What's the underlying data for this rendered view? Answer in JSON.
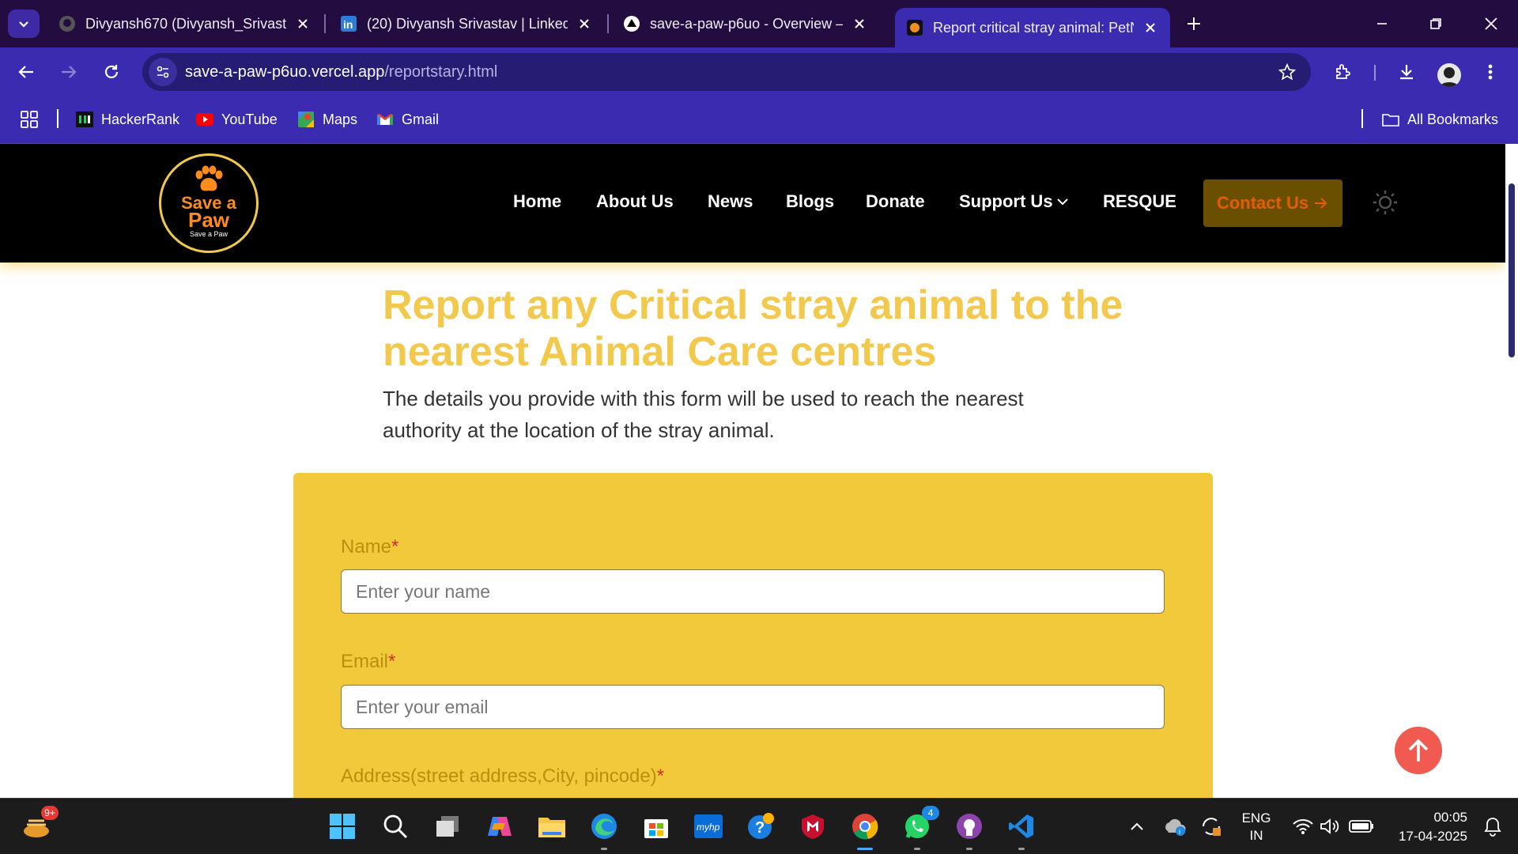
{
  "tabs": [
    {
      "title": "Divyansh670 (Divyansh_Srivasta",
      "icon": "github-icon"
    },
    {
      "title": "(20) Divyansh Srivastav | LinkedI",
      "icon": "linkedin-icon"
    },
    {
      "title": "save-a-paw-p6uo - Overview –",
      "icon": "vercel-icon"
    },
    {
      "title": "Report critical stray animal: PetN",
      "icon": "save-a-paw-icon"
    }
  ],
  "omnibox": {
    "domain": "save-a-paw-p6uo.vercel.app",
    "path": "/reportstary.html"
  },
  "bookmarks": {
    "items": [
      {
        "label": "HackerRank",
        "icon": "hackerrank-icon"
      },
      {
        "label": "YouTube",
        "icon": "youtube-icon"
      },
      {
        "label": "Maps",
        "icon": "maps-icon"
      },
      {
        "label": "Gmail",
        "icon": "gmail-icon"
      }
    ],
    "all_bookmarks": "All Bookmarks"
  },
  "site": {
    "logo": {
      "line1": "Save a",
      "line2": "Paw",
      "line3": "Save a Paw"
    },
    "nav": [
      "Home",
      "About Us",
      "News",
      "Blogs",
      "Donate",
      "Support Us",
      "RESQUE"
    ],
    "contact_label": "Contact Us",
    "heading": "Report any Critical stray animal to the nearest Animal Care centres",
    "lead": "The details you provide with this form will be used to reach the nearest authority at the location of the stray animal.",
    "form": {
      "name_label": "Name",
      "name_placeholder": "Enter your name",
      "email_label": "Email",
      "email_placeholder": "Enter your email",
      "address_label": "Address(street address,City, pincode)",
      "required_mark": "*"
    }
  },
  "colors": {
    "accent": "#f2c94c",
    "chrome": "#3a2bb0",
    "scroll_top": "#f05a50"
  },
  "taskbar": {
    "notification_badge": "9+",
    "whatsapp_badge": "4",
    "lang_top": "ENG",
    "lang_bottom": "IN",
    "time": "00:05",
    "date": "17-04-2025"
  }
}
